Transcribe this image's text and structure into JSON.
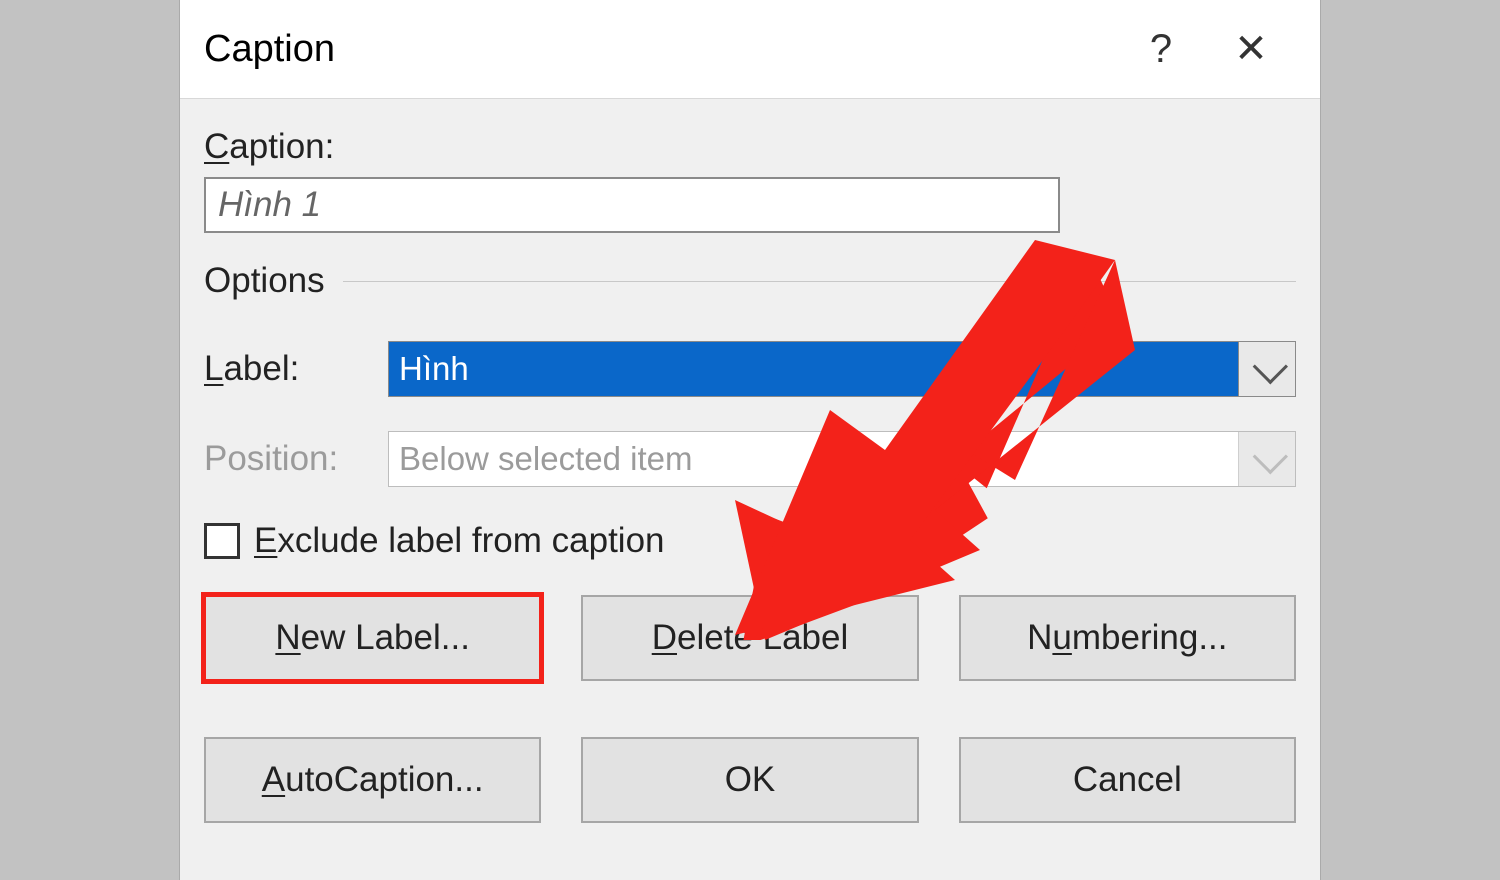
{
  "titlebar": {
    "title": "Caption",
    "help": "?",
    "close": "✕"
  },
  "labels": {
    "caption": "Caption:",
    "options": "Options",
    "label": "Label:",
    "position": "Position:",
    "exclude": "Exclude label from caption"
  },
  "fields": {
    "caption_value": "Hình 1",
    "label_selected": "Hình",
    "position_value": "Below selected item"
  },
  "buttons": {
    "new_label": "New Label...",
    "delete_label": "Delete Label",
    "numbering": "Numbering...",
    "autocaption": "AutoCaption...",
    "ok": "OK",
    "cancel": "Cancel"
  },
  "underline": {
    "caption": "C",
    "label": "L",
    "exclude": "E",
    "new": "N",
    "delete": "D",
    "numbering": "u",
    "autocaption": "A"
  }
}
